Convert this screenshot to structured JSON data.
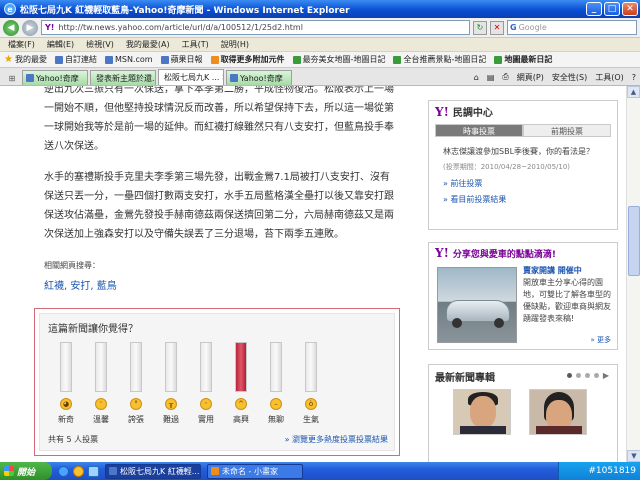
{
  "window": {
    "title": "松阪七局九K 紅襪輕取藍鳥-Yahoo!奇摩新聞 - Windows Internet Explorer",
    "minimize": "_",
    "maximize": "□",
    "close": "✕"
  },
  "address": {
    "url": "http://tw.news.yahoo.com/article/url/d/a/100512/1/25d2.html",
    "search_placeholder": "Google"
  },
  "menu": [
    "檔案(F)",
    "編輯(E)",
    "檢視(V)",
    "我的最愛(A)",
    "工具(T)",
    "說明(H)"
  ],
  "favorites": {
    "label": "我的最愛",
    "items": [
      "自訂連結",
      "MSN.com",
      "蘋果日報",
      "取得更多附加元件",
      "最夯美女地圖-地圖日記",
      "全台推薦景點-地圖日記",
      "地圖最新日記"
    ]
  },
  "tabs": [
    "Yahoo!奇摩",
    "發表新主題於還...",
    "松阪七局九K ...",
    "Yahoo!奇摩"
  ],
  "toolbar_right": [
    "網頁(P)",
    "安全性(S)",
    "工具(O)"
  ],
  "article": {
    "paragraphs": [
      "逆出九次三振只有一次保送，拿下本季第二勝，平成怪物復活。松阪表示上一場一開始不順，但他堅持投球情況反而改善，所以希望保持下去，所以這一場從第一球開始我等於是前一場的延伸。而紅襪打線雖然只有八支安打，但藍鳥投手奉送八次保送。",
      "水手的塞禮斯投手克里夫李季第三場先發，出戰金鶯7.1局被打八支安打、沒有保送只丟一分，一壘四個打數兩支安打，水手五局藍格漢全壘打以後又靠安打跟保送攻佔滿壘，金鶯先發投手赫南德茲兩保送擠回第二分，六局赫南德茲又是兩次保送加上強森安打以及守備失誤丟了三分退場，苔下兩季五連敗。"
    ],
    "related_title": "相關網頁搜尋：",
    "related_links": "紅襪, 安打, 藍鳥"
  },
  "poll": {
    "question": "這篇新聞讓你覺得？",
    "options": [
      {
        "label": "新奇",
        "level": 0
      },
      {
        "label": "溫馨",
        "level": 0
      },
      {
        "label": "誇張",
        "level": 0
      },
      {
        "label": "難過",
        "level": 0
      },
      {
        "label": "實用",
        "level": 0
      },
      {
        "label": "高興",
        "level": 1.0
      },
      {
        "label": "無聊",
        "level": 0
      },
      {
        "label": "生氣",
        "level": 0
      }
    ],
    "count_text": "共有 5 人投票",
    "more_link": "» 瀏覽更多熱度投票投票結果"
  },
  "sidebar": {
    "center": {
      "title": "民調中心",
      "tab_on": "時事投票",
      "tab_off": "前期投票",
      "question": "林志傑讓渡參加SBL季後賽，你的看法是？",
      "date": "(投票期間：2010/04/28~2010/05/10)",
      "link1": "» 前往投票",
      "link2": "» 看目前投票結果"
    },
    "ad": {
      "headline": "分享您與愛車的點點滴滴!",
      "title": "賣家開講 開催中",
      "text": "開放車主分享心得的園地，可雙比了解各車型的優缺點，歡迎車商與網友踴躍發表來稿!",
      "more": "» 更多"
    },
    "news": {
      "title": "最新新聞專輯"
    }
  },
  "taskbar": {
    "start": "開始",
    "items": [
      "松阪七局九K 紅襪輕...",
      "未命名 - 小畫家"
    ],
    "watermark": "#1051819"
  }
}
